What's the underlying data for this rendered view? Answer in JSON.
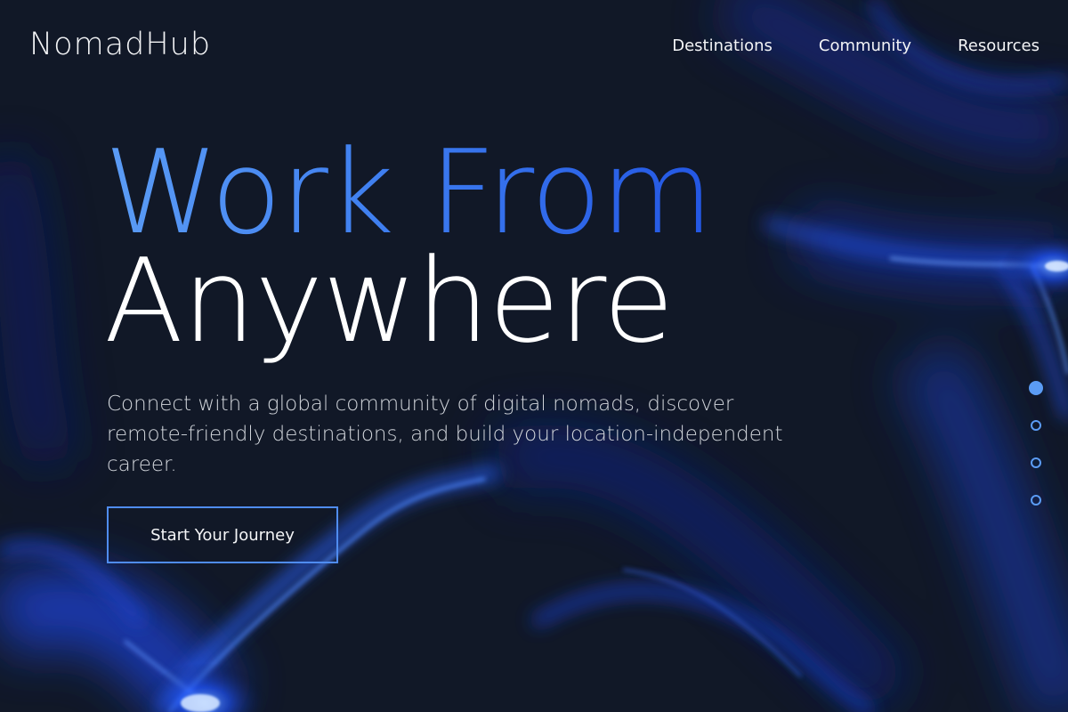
{
  "brand": {
    "name": "NomadHub"
  },
  "nav": {
    "items": [
      {
        "label": "Destinations"
      },
      {
        "label": "Community"
      },
      {
        "label": "Resources"
      }
    ]
  },
  "hero": {
    "title_line1": "Work From",
    "title_line2": "Anywhere",
    "subtitle": "Connect with a global community of digital nomads, discover remote-friendly destinations, and build your location-independent career.",
    "cta_label": "Start Your Journey"
  },
  "slider": {
    "slide_count": 4,
    "active_index": 0
  },
  "colors": {
    "background": "#111827",
    "accent": "#4f8cf0",
    "accent_light": "#5b9cf5",
    "accent_dark": "#2356e3",
    "text": "#f3f4f6",
    "muted_text": "#d1d5db"
  }
}
